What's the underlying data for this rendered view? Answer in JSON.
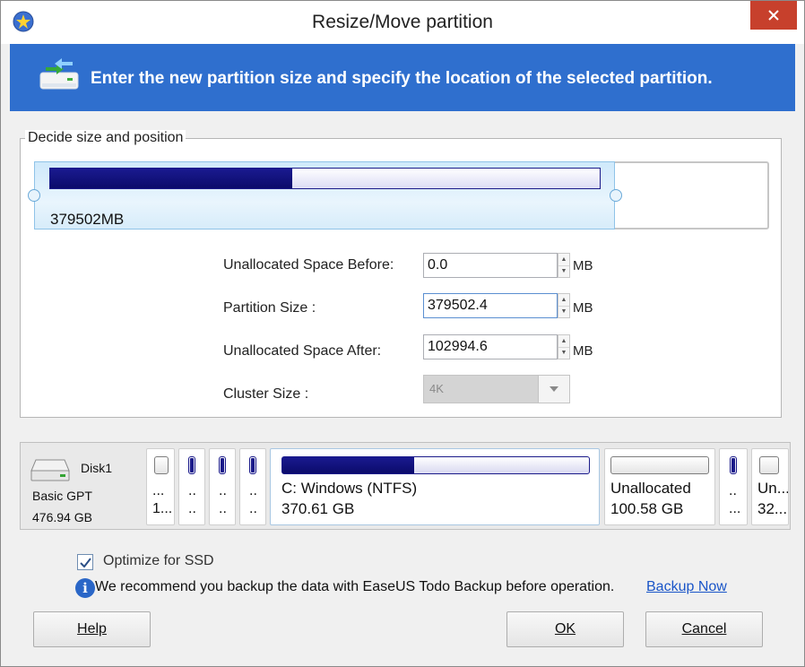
{
  "window": {
    "title": "Resize/Move partition"
  },
  "banner": {
    "text": "Enter the new partition size and specify the location of the selected partition."
  },
  "group": {
    "title": "Decide size and position",
    "partition_label": "379502MB",
    "used_fraction": 0.44
  },
  "fields": {
    "before_label": "Unallocated Space Before:",
    "before_value": "0.0",
    "size_label": "Partition Size :",
    "size_value": "379502.4",
    "after_label": "Unallocated Space After:",
    "after_value": "102994.6",
    "unit": "MB",
    "cluster_label": "Cluster Size :",
    "cluster_value": "4K"
  },
  "disk": {
    "name": "Disk1",
    "type": "Basic GPT",
    "size": "476.94 GB",
    "partitions": [
      {
        "line1": "...",
        "line2": "1..."
      },
      {
        "line1": "..",
        "line2": ".."
      },
      {
        "line1": "..",
        "line2": ".."
      },
      {
        "line1": "..",
        "line2": ".."
      },
      {
        "line1": "C: Windows (NTFS)",
        "line2": "370.61 GB",
        "used_fraction": 0.43
      },
      {
        "line1": "Unallocated",
        "line2": "100.58 GB"
      },
      {
        "line1": "..",
        "line2": "..."
      },
      {
        "line1": "Un...",
        "line2": "32..."
      }
    ]
  },
  "options": {
    "optimize_ssd_label": "Optimize for SSD",
    "optimize_ssd_checked": true,
    "recommend_text": "We recommend you backup the data with EaseUS Todo Backup before operation.",
    "backup_link": "Backup Now"
  },
  "buttons": {
    "help": "Help",
    "ok": "OK",
    "cancel": "Cancel"
  },
  "colors": {
    "banner": "#2f6fce",
    "bar": "#1b1b8a",
    "close": "#c7402c",
    "link": "#1a55c8"
  }
}
